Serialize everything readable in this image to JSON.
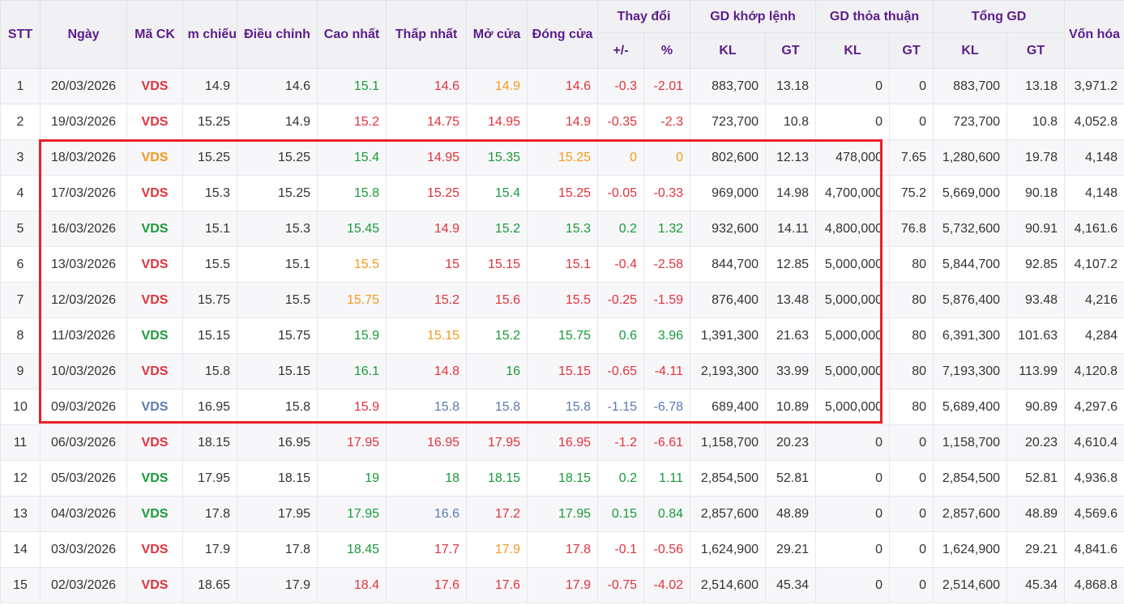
{
  "headers": {
    "stt": "STT",
    "date": "Ngày",
    "symbol": "Mã CK",
    "ref_clipped": "m chiếu",
    "adjusted": "Điều chỉnh",
    "high": "Cao nhất",
    "low": "Thấp nhất",
    "open": "Mở cửa",
    "close": "Đóng cửa",
    "change_group": "Thay đổi",
    "change_abs": "+/-",
    "change_pct": "%",
    "matched_group": "GD khớp lệnh",
    "agreed_group": "GD thỏa thuận",
    "total_group": "Tổng GD",
    "kl": "KL",
    "gt": "GT",
    "market_cap": "Vốn hóa"
  },
  "colors": {
    "up": "#1a9a3a",
    "down": "#e0333c",
    "ref": "#f39a1c",
    "floor": "#5b7ab0",
    "header_text": "#5b1d8a",
    "highlight_border": "#e8202a"
  },
  "rows": [
    {
      "stt": "1",
      "date": "20/03/2026",
      "symbol": "VDS",
      "symbol_color": "down",
      "ref": "14.9",
      "adj": "14.6",
      "high": "15.1",
      "high_color": "up",
      "low": "14.6",
      "low_color": "down",
      "open": "14.9",
      "open_color": "ref",
      "close": "14.6",
      "close_color": "down",
      "chg": "-0.3",
      "pct": "-2.01",
      "chg_color": "down",
      "m_kl": "883,700",
      "m_gt": "13.18",
      "a_kl": "0",
      "a_gt": "0",
      "t_kl": "883,700",
      "t_gt": "13.18",
      "cap": "3,971.2"
    },
    {
      "stt": "2",
      "date": "19/03/2026",
      "symbol": "VDS",
      "symbol_color": "down",
      "ref": "15.25",
      "adj": "14.9",
      "high": "15.2",
      "high_color": "down",
      "low": "14.75",
      "low_color": "down",
      "open": "14.95",
      "open_color": "down",
      "close": "14.9",
      "close_color": "down",
      "chg": "-0.35",
      "pct": "-2.3",
      "chg_color": "down",
      "m_kl": "723,700",
      "m_gt": "10.8",
      "a_kl": "0",
      "a_gt": "0",
      "t_kl": "723,700",
      "t_gt": "10.8",
      "cap": "4,052.8"
    },
    {
      "stt": "3",
      "date": "18/03/2026",
      "symbol": "VDS",
      "symbol_color": "ref",
      "ref": "15.25",
      "adj": "15.25",
      "high": "15.4",
      "high_color": "up",
      "low": "14.95",
      "low_color": "down",
      "open": "15.35",
      "open_color": "up",
      "close": "15.25",
      "close_color": "ref",
      "chg": "0",
      "pct": "0",
      "chg_color": "ref",
      "m_kl": "802,600",
      "m_gt": "12.13",
      "a_kl": "478,000",
      "a_gt": "7.65",
      "t_kl": "1,280,600",
      "t_gt": "19.78",
      "cap": "4,148"
    },
    {
      "stt": "4",
      "date": "17/03/2026",
      "symbol": "VDS",
      "symbol_color": "down",
      "ref": "15.3",
      "adj": "15.25",
      "high": "15.8",
      "high_color": "up",
      "low": "15.25",
      "low_color": "down",
      "open": "15.4",
      "open_color": "up",
      "close": "15.25",
      "close_color": "down",
      "chg": "-0.05",
      "pct": "-0.33",
      "chg_color": "down",
      "m_kl": "969,000",
      "m_gt": "14.98",
      "a_kl": "4,700,000",
      "a_gt": "75.2",
      "t_kl": "5,669,000",
      "t_gt": "90.18",
      "cap": "4,148"
    },
    {
      "stt": "5",
      "date": "16/03/2026",
      "symbol": "VDS",
      "symbol_color": "up",
      "ref": "15.1",
      "adj": "15.3",
      "high": "15.45",
      "high_color": "up",
      "low": "14.9",
      "low_color": "down",
      "open": "15.2",
      "open_color": "up",
      "close": "15.3",
      "close_color": "up",
      "chg": "0.2",
      "pct": "1.32",
      "chg_color": "up",
      "m_kl": "932,600",
      "m_gt": "14.11",
      "a_kl": "4,800,000",
      "a_gt": "76.8",
      "t_kl": "5,732,600",
      "t_gt": "90.91",
      "cap": "4,161.6"
    },
    {
      "stt": "6",
      "date": "13/03/2026",
      "symbol": "VDS",
      "symbol_color": "down",
      "ref": "15.5",
      "adj": "15.1",
      "high": "15.5",
      "high_color": "ref",
      "low": "15",
      "low_color": "down",
      "open": "15.15",
      "open_color": "down",
      "close": "15.1",
      "close_color": "down",
      "chg": "-0.4",
      "pct": "-2.58",
      "chg_color": "down",
      "m_kl": "844,700",
      "m_gt": "12.85",
      "a_kl": "5,000,000",
      "a_gt": "80",
      "t_kl": "5,844,700",
      "t_gt": "92.85",
      "cap": "4,107.2"
    },
    {
      "stt": "7",
      "date": "12/03/2026",
      "symbol": "VDS",
      "symbol_color": "down",
      "ref": "15.75",
      "adj": "15.5",
      "high": "15.75",
      "high_color": "ref",
      "low": "15.2",
      "low_color": "down",
      "open": "15.6",
      "open_color": "down",
      "close": "15.5",
      "close_color": "down",
      "chg": "-0.25",
      "pct": "-1.59",
      "chg_color": "down",
      "m_kl": "876,400",
      "m_gt": "13.48",
      "a_kl": "5,000,000",
      "a_gt": "80",
      "t_kl": "5,876,400",
      "t_gt": "93.48",
      "cap": "4,216"
    },
    {
      "stt": "8",
      "date": "11/03/2026",
      "symbol": "VDS",
      "symbol_color": "up",
      "ref": "15.15",
      "adj": "15.75",
      "high": "15.9",
      "high_color": "up",
      "low": "15.15",
      "low_color": "ref",
      "open": "15.2",
      "open_color": "up",
      "close": "15.75",
      "close_color": "up",
      "chg": "0.6",
      "pct": "3.96",
      "chg_color": "up",
      "m_kl": "1,391,300",
      "m_gt": "21.63",
      "a_kl": "5,000,000",
      "a_gt": "80",
      "t_kl": "6,391,300",
      "t_gt": "101.63",
      "cap": "4,284"
    },
    {
      "stt": "9",
      "date": "10/03/2026",
      "symbol": "VDS",
      "symbol_color": "down",
      "ref": "15.8",
      "adj": "15.15",
      "high": "16.1",
      "high_color": "up",
      "low": "14.8",
      "low_color": "down",
      "open": "16",
      "open_color": "up",
      "close": "15.15",
      "close_color": "down",
      "chg": "-0.65",
      "pct": "-4.11",
      "chg_color": "down",
      "m_kl": "2,193,300",
      "m_gt": "33.99",
      "a_kl": "5,000,000",
      "a_gt": "80",
      "t_kl": "7,193,300",
      "t_gt": "113.99",
      "cap": "4,120.8"
    },
    {
      "stt": "10",
      "date": "09/03/2026",
      "symbol": "VDS",
      "symbol_color": "floor",
      "ref": "16.95",
      "adj": "15.8",
      "high": "15.9",
      "high_color": "down",
      "low": "15.8",
      "low_color": "floor",
      "open": "15.8",
      "open_color": "floor",
      "close": "15.8",
      "close_color": "floor",
      "chg": "-1.15",
      "pct": "-6.78",
      "chg_color": "floor",
      "m_kl": "689,400",
      "m_gt": "10.89",
      "a_kl": "5,000,000",
      "a_gt": "80",
      "t_kl": "5,689,400",
      "t_gt": "90.89",
      "cap": "4,297.6"
    },
    {
      "stt": "11",
      "date": "06/03/2026",
      "symbol": "VDS",
      "symbol_color": "down",
      "ref": "18.15",
      "adj": "16.95",
      "high": "17.95",
      "high_color": "down",
      "low": "16.95",
      "low_color": "down",
      "open": "17.95",
      "open_color": "down",
      "close": "16.95",
      "close_color": "down",
      "chg": "-1.2",
      "pct": "-6.61",
      "chg_color": "down",
      "m_kl": "1,158,700",
      "m_gt": "20.23",
      "a_kl": "0",
      "a_gt": "0",
      "t_kl": "1,158,700",
      "t_gt": "20.23",
      "cap": "4,610.4"
    },
    {
      "stt": "12",
      "date": "05/03/2026",
      "symbol": "VDS",
      "symbol_color": "up",
      "ref": "17.95",
      "adj": "18.15",
      "high": "19",
      "high_color": "up",
      "low": "18",
      "low_color": "up",
      "open": "18.15",
      "open_color": "up",
      "close": "18.15",
      "close_color": "up",
      "chg": "0.2",
      "pct": "1.11",
      "chg_color": "up",
      "m_kl": "2,854,500",
      "m_gt": "52.81",
      "a_kl": "0",
      "a_gt": "0",
      "t_kl": "2,854,500",
      "t_gt": "52.81",
      "cap": "4,936.8"
    },
    {
      "stt": "13",
      "date": "04/03/2026",
      "symbol": "VDS",
      "symbol_color": "up",
      "ref": "17.8",
      "adj": "17.95",
      "high": "17.95",
      "high_color": "up",
      "low": "16.6",
      "low_color": "floor",
      "open": "17.2",
      "open_color": "down",
      "close": "17.95",
      "close_color": "up",
      "chg": "0.15",
      "pct": "0.84",
      "chg_color": "up",
      "m_kl": "2,857,600",
      "m_gt": "48.89",
      "a_kl": "0",
      "a_gt": "0",
      "t_kl": "2,857,600",
      "t_gt": "48.89",
      "cap": "4,569.6"
    },
    {
      "stt": "14",
      "date": "03/03/2026",
      "symbol": "VDS",
      "symbol_color": "down",
      "ref": "17.9",
      "adj": "17.8",
      "high": "18.45",
      "high_color": "up",
      "low": "17.7",
      "low_color": "down",
      "open": "17.9",
      "open_color": "ref",
      "close": "17.8",
      "close_color": "down",
      "chg": "-0.1",
      "pct": "-0.56",
      "chg_color": "down",
      "m_kl": "1,624,900",
      "m_gt": "29.21",
      "a_kl": "0",
      "a_gt": "0",
      "t_kl": "1,624,900",
      "t_gt": "29.21",
      "cap": "4,841.6"
    },
    {
      "stt": "15",
      "date": "02/03/2026",
      "symbol": "VDS",
      "symbol_color": "down",
      "ref": "18.65",
      "adj": "17.9",
      "high": "18.4",
      "high_color": "down",
      "low": "17.6",
      "low_color": "down",
      "open": "17.6",
      "open_color": "down",
      "close": "17.9",
      "close_color": "down",
      "chg": "-0.75",
      "pct": "-4.02",
      "chg_color": "down",
      "m_kl": "2,514,600",
      "m_gt": "45.34",
      "a_kl": "0",
      "a_gt": "0",
      "t_kl": "2,514,600",
      "t_gt": "45.34",
      "cap": "4,868.8"
    }
  ]
}
